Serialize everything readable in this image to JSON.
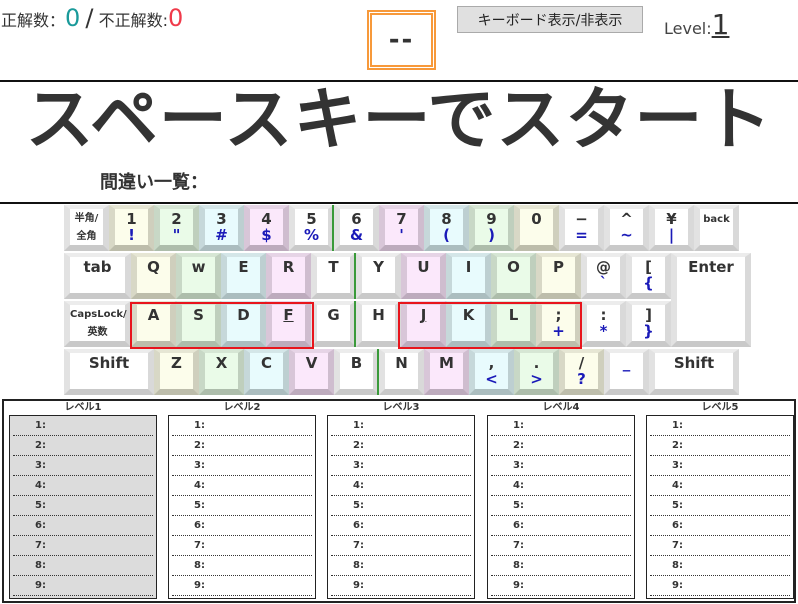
{
  "score": {
    "correct_label": "正解数：",
    "correct_value": "0",
    "separator": "/",
    "incorrect_label": "不正解数:",
    "incorrect_value": "0"
  },
  "current_key": "--",
  "toggle_keyboard_button": "キーボード表示/非表示",
  "level": {
    "label": "Level:",
    "value": "1"
  },
  "start_message": "スペースキーでスタート",
  "mistakes_label": "間違い一覧：",
  "keyboard": {
    "row1": [
      {
        "main": "半角/\n全角",
        "sub": "",
        "color": "w",
        "type": "fn"
      },
      {
        "main": "1",
        "sub": "!",
        "color": "y"
      },
      {
        "main": "2",
        "sub": "\"",
        "color": "g"
      },
      {
        "main": "3",
        "sub": "#",
        "color": "c"
      },
      {
        "main": "4",
        "sub": "$",
        "color": "p"
      },
      {
        "main": "5",
        "sub": "%",
        "color": "w"
      },
      {
        "main": "6",
        "sub": "&",
        "color": "w"
      },
      {
        "main": "7",
        "sub": "'",
        "color": "p"
      },
      {
        "main": "8",
        "sub": "(",
        "color": "c"
      },
      {
        "main": "9",
        "sub": ")",
        "color": "g"
      },
      {
        "main": "0",
        "sub": "",
        "color": "y"
      },
      {
        "main": "−",
        "sub": "=",
        "color": "w"
      },
      {
        "main": "^",
        "sub": "~",
        "color": "w"
      },
      {
        "main": "¥",
        "sub": "|",
        "color": "w"
      },
      {
        "main": "back",
        "sub": "",
        "color": "w",
        "type": "small"
      }
    ],
    "row2": [
      {
        "main": "tab",
        "sub": "",
        "color": "w"
      },
      {
        "main": "Q",
        "sub": "",
        "color": "y"
      },
      {
        "main": "w",
        "sub": "",
        "color": "g"
      },
      {
        "main": "E",
        "sub": "",
        "color": "c"
      },
      {
        "main": "R",
        "sub": "",
        "color": "p"
      },
      {
        "main": "T",
        "sub": "",
        "color": "w"
      },
      {
        "main": "Y",
        "sub": "",
        "color": "w"
      },
      {
        "main": "U",
        "sub": "",
        "color": "p"
      },
      {
        "main": "I",
        "sub": "",
        "color": "c"
      },
      {
        "main": "O",
        "sub": "",
        "color": "g"
      },
      {
        "main": "P",
        "sub": "",
        "color": "y"
      },
      {
        "main": "@",
        "sub": "`",
        "color": "w"
      },
      {
        "main": "[",
        "sub": "{",
        "color": "w"
      },
      {
        "main": "Enter",
        "sub": "",
        "color": "w"
      }
    ],
    "row3": [
      {
        "main": "CapsLock/\n英数",
        "sub": "",
        "color": "w",
        "type": "fn"
      },
      {
        "main": "A",
        "sub": "",
        "color": "y"
      },
      {
        "main": "S",
        "sub": "",
        "color": "g"
      },
      {
        "main": "D",
        "sub": "",
        "color": "c"
      },
      {
        "main": "F",
        "sub": "",
        "color": "p",
        "underline": true
      },
      {
        "main": "G",
        "sub": "",
        "color": "w"
      },
      {
        "main": "H",
        "sub": "",
        "color": "w"
      },
      {
        "main": "J",
        "sub": "",
        "color": "p",
        "underline": true
      },
      {
        "main": "K",
        "sub": "",
        "color": "c"
      },
      {
        "main": "L",
        "sub": "",
        "color": "g"
      },
      {
        "main": ";",
        "sub": "+",
        "color": "y"
      },
      {
        "main": ":",
        "sub": "*",
        "color": "w"
      },
      {
        "main": "]",
        "sub": "}",
        "color": "w"
      }
    ],
    "row4": [
      {
        "main": "Shift",
        "sub": "",
        "color": "w"
      },
      {
        "main": "Z",
        "sub": "",
        "color": "y"
      },
      {
        "main": "X",
        "sub": "",
        "color": "g"
      },
      {
        "main": "C",
        "sub": "",
        "color": "c"
      },
      {
        "main": "V",
        "sub": "",
        "color": "p"
      },
      {
        "main": "B",
        "sub": "",
        "color": "w"
      },
      {
        "main": "N",
        "sub": "",
        "color": "w"
      },
      {
        "main": "M",
        "sub": "",
        "color": "p"
      },
      {
        "main": ",",
        "sub": "<",
        "color": "c"
      },
      {
        "main": ".",
        "sub": ">",
        "color": "g"
      },
      {
        "main": "/",
        "sub": "?",
        "color": "y"
      },
      {
        "main": "",
        "sub": "_",
        "color": "w"
      },
      {
        "main": "Shift",
        "sub": "",
        "color": "w"
      }
    ]
  },
  "levels": [
    {
      "title": "レベル1",
      "active": true,
      "rows": [
        "1:",
        "2:",
        "3:",
        "4:",
        "5:",
        "6:",
        "7:",
        "8:",
        "9:"
      ]
    },
    {
      "title": "レベル2",
      "active": false,
      "rows": [
        "1:",
        "2:",
        "3:",
        "4:",
        "5:",
        "6:",
        "7:",
        "8:",
        "9:"
      ]
    },
    {
      "title": "レベル3",
      "active": false,
      "rows": [
        "1:",
        "2:",
        "3:",
        "4:",
        "5:",
        "6:",
        "7:",
        "8:",
        "9:"
      ]
    },
    {
      "title": "レベル4",
      "active": false,
      "rows": [
        "1:",
        "2:",
        "3:",
        "4:",
        "5:",
        "6:",
        "7:",
        "8:",
        "9:"
      ]
    },
    {
      "title": "レベル5",
      "active": false,
      "rows": [
        "1:",
        "2:",
        "3:",
        "4:",
        "5:",
        "6:",
        "7:",
        "8:",
        "9:"
      ]
    }
  ],
  "colors": {
    "correct": "#1a9a9a",
    "incorrect": "#f03a4a",
    "current_key_border": "#f7993a",
    "home_row_highlight": "#e8141c",
    "finger_yellow": "#fcfdeb",
    "finger_green": "#eafbe8",
    "finger_cyan": "#e8fbfd",
    "finger_pink": "#fbe8fb"
  }
}
